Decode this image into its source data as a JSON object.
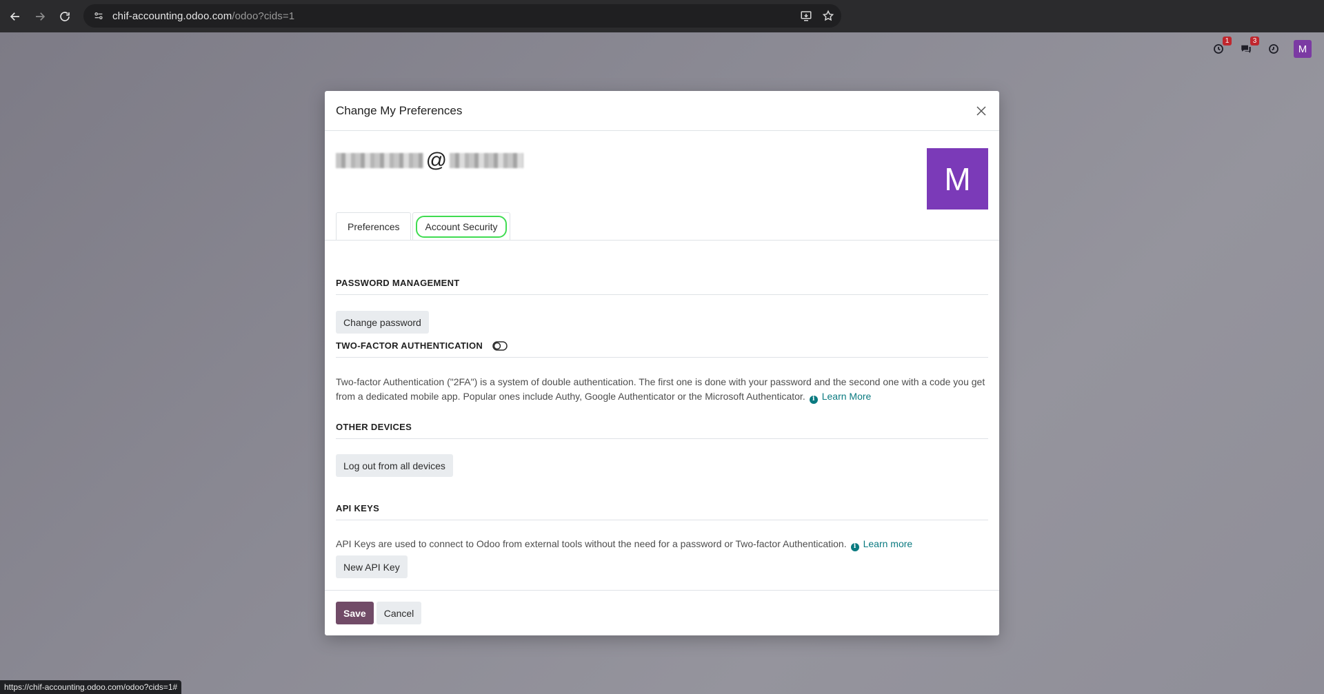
{
  "browser": {
    "url_host": "chif-accounting.odoo.com",
    "url_path": "/odoo?cids=1",
    "status_url": "https://chif-accounting.odoo.com/odoo?cids=1#"
  },
  "systray": {
    "activity_badge": "1",
    "messages_badge": "3",
    "avatar_letter": "M"
  },
  "modal": {
    "title": "Change My Preferences",
    "user_at": "@",
    "avatar_letter": "M",
    "tabs": [
      {
        "label": "Preferences",
        "active": false
      },
      {
        "label": "Account Security",
        "active": true
      }
    ],
    "password": {
      "title": "PASSWORD MANAGEMENT",
      "button": "Change password"
    },
    "two_factor": {
      "title": "TWO-FACTOR AUTHENTICATION",
      "description": "Two-factor Authentication (\"2FA\") is a system of double authentication. The first one is done with your password and the second one with a code you get from a dedicated mobile app. Popular ones include Authy, Google Authenticator or the Microsoft Authenticator.",
      "link": "Learn More"
    },
    "devices": {
      "title": "OTHER DEVICES",
      "button": "Log out from all devices"
    },
    "api_keys": {
      "title": "API KEYS",
      "description": "API Keys are used to connect to Odoo from external tools without the need for a password or Two-factor Authentication.",
      "link": "Learn more",
      "button": "New API Key"
    },
    "footer": {
      "save": "Save",
      "cancel": "Cancel"
    }
  },
  "colors": {
    "primary": "#714b67",
    "avatar": "#7b3ab8",
    "link": "#0a7a80",
    "focus_ring": "#3fdc51"
  }
}
